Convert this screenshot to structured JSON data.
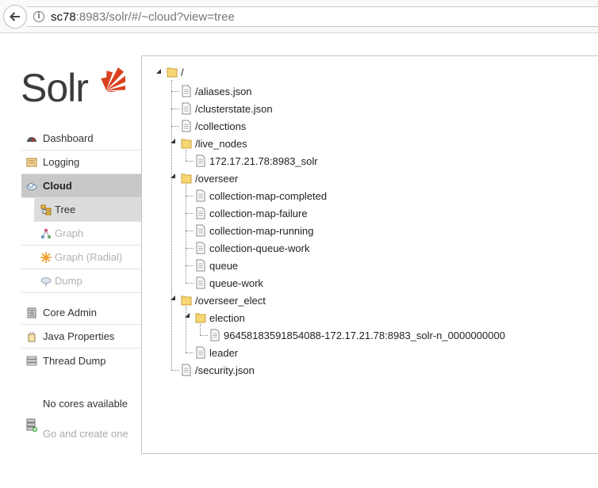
{
  "browser": {
    "url_host": "sc78",
    "url_rest": ":8983/solr/#/~cloud?view=tree"
  },
  "logo": {
    "text": "Solr",
    "accent_color": "#d9411e"
  },
  "nav": {
    "dashboard": "Dashboard",
    "logging": "Logging",
    "cloud": "Cloud",
    "tree": "Tree",
    "graph": "Graph",
    "graph_radial": "Graph (Radial)",
    "dump": "Dump",
    "core_admin": "Core Admin",
    "java_properties": "Java Properties",
    "thread_dump": "Thread Dump"
  },
  "cores": {
    "none": "No cores available",
    "create": "Go and create one"
  },
  "tree": {
    "root": "/",
    "aliases": "/aliases.json",
    "clusterstate": "/clusterstate.json",
    "collections": "/collections",
    "live_nodes": "/live_nodes",
    "live_node_1": "172.17.21.78:8983_solr",
    "overseer": "/overseer",
    "cmap_completed": "collection-map-completed",
    "cmap_failure": "collection-map-failure",
    "cmap_running": "collection-map-running",
    "cqueue_work": "collection-queue-work",
    "queue": "queue",
    "queue_work": "queue-work",
    "overseer_elect": "/overseer_elect",
    "election": "election",
    "election_node": "96458183591854088-172.17.21.78:8983_solr-n_0000000000",
    "leader": "leader",
    "security": "/security.json"
  }
}
